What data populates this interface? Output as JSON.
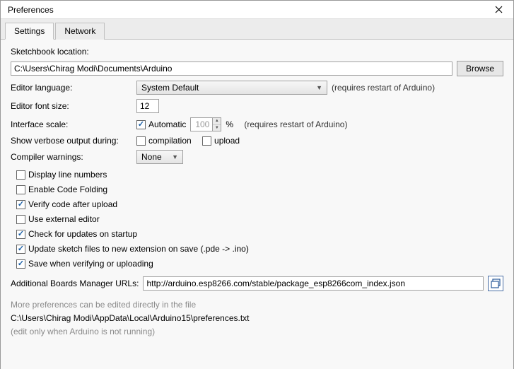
{
  "window": {
    "title": "Preferences"
  },
  "tabs": {
    "settings": "Settings",
    "network": "Network"
  },
  "labels": {
    "sketchbook": "Sketchbook location:",
    "editor_language": "Editor language:",
    "editor_font_size": "Editor font size:",
    "interface_scale": "Interface scale:",
    "show_verbose": "Show verbose output during:",
    "compiler_warnings": "Compiler warnings:",
    "additional_urls": "Additional Boards Manager URLs:"
  },
  "values": {
    "sketchbook_path": "C:\\Users\\Chirag Modi\\Documents\\Arduino",
    "browse_btn": "Browse",
    "language_selected": "System Default",
    "language_hint": "(requires restart of Arduino)",
    "font_size": "12",
    "scale_automatic_label": "Automatic",
    "scale_value": "100",
    "scale_percent": "%",
    "scale_hint": "(requires restart of Arduino)",
    "verbose_compilation": "compilation",
    "verbose_upload": "upload",
    "warnings_selected": "None",
    "urls_value": "http://arduino.esp8266.com/stable/package_esp8266com_index.json"
  },
  "checkboxes": [
    {
      "label": "Display line numbers",
      "checked": false
    },
    {
      "label": "Enable Code Folding",
      "checked": false
    },
    {
      "label": "Verify code after upload",
      "checked": true
    },
    {
      "label": "Use external editor",
      "checked": false
    },
    {
      "label": "Check for updates on startup",
      "checked": true
    },
    {
      "label": "Update sketch files to new extension on save (.pde -> .ino)",
      "checked": true
    },
    {
      "label": "Save when verifying or uploading",
      "checked": true
    }
  ],
  "footer": {
    "line1": "More preferences can be edited directly in the file",
    "line2": "C:\\Users\\Chirag Modi\\AppData\\Local\\Arduino15\\preferences.txt",
    "line3": "(edit only when Arduino is not running)"
  }
}
